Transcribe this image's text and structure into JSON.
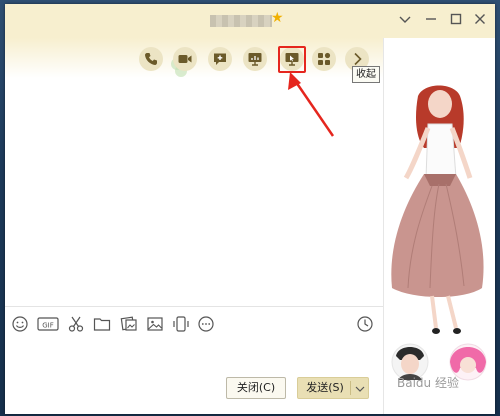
{
  "window": {
    "title_star": "★",
    "controls": [
      "chevron-down",
      "minimize",
      "maximize",
      "close"
    ]
  },
  "toolbar": {
    "buttons": [
      "phone-call",
      "video-call",
      "add-message",
      "screen-share",
      "remote-assist",
      "apps",
      "more"
    ],
    "tooltip": "收起"
  },
  "input_toolbar": {
    "icons": [
      "emoji",
      "gif",
      "screenshot-scissors",
      "folder",
      "image-transfer",
      "picture",
      "shake-window",
      "more",
      "history"
    ],
    "gif_label": "GIF"
  },
  "footer": {
    "close_label": "关闭(C)",
    "send_label": "发送(S)"
  },
  "watermark": "Baidu 经验"
}
